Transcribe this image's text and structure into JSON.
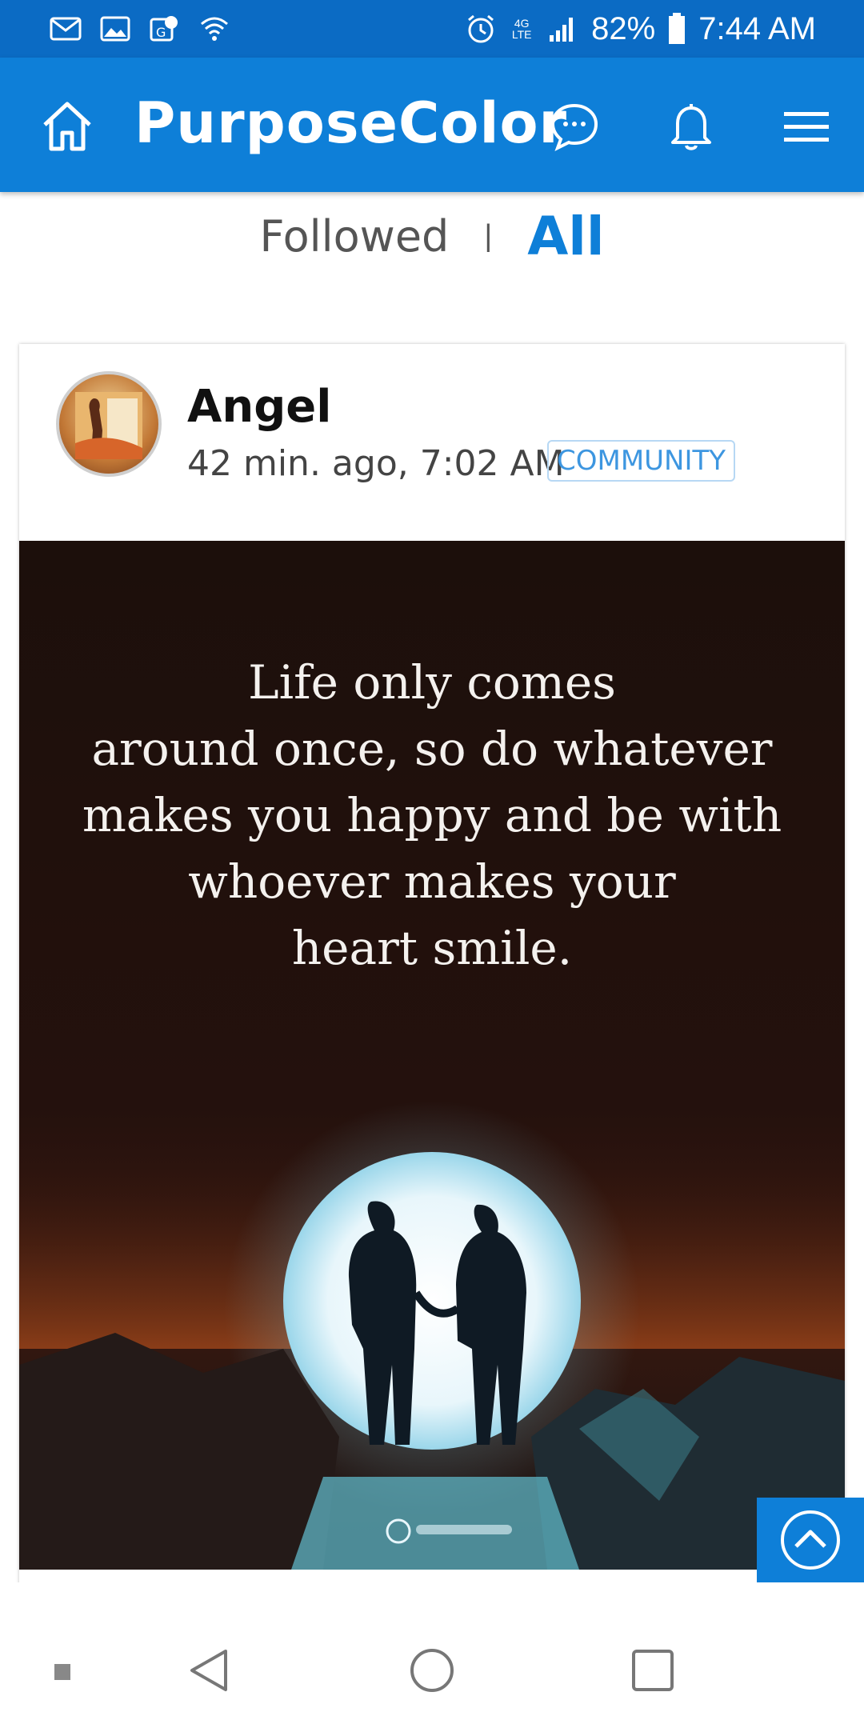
{
  "status_bar": {
    "battery": "82%",
    "time": "7:44 AM",
    "network": "4G LTE",
    "left_icons": [
      "gmail-icon",
      "gallery-icon",
      "maps-icon",
      "wifi-icon"
    ],
    "right_icons": [
      "alarm-icon",
      "data-icon",
      "signal-icon",
      "battery-icon"
    ]
  },
  "app_bar": {
    "title": "PurposeColor",
    "icons": [
      "home-icon",
      "chat-icon",
      "bell-icon",
      "menu-icon"
    ],
    "color": "#0e7fd8"
  },
  "tabs": {
    "followed": "Followed",
    "separator": "|",
    "all": "All"
  },
  "post": {
    "author": "Angel",
    "time": "42 min. ago, 7:02 AM",
    "badge": "COMMUNITY",
    "quote_lines": [
      "Life only comes",
      "around once, so do whatever",
      "makes you happy and be with",
      "whoever makes your",
      "heart smile."
    ]
  },
  "colors": {
    "accent": "#0e7fd8",
    "status_bar": "#0b6bc4",
    "badge_text": "#3d96e0"
  }
}
